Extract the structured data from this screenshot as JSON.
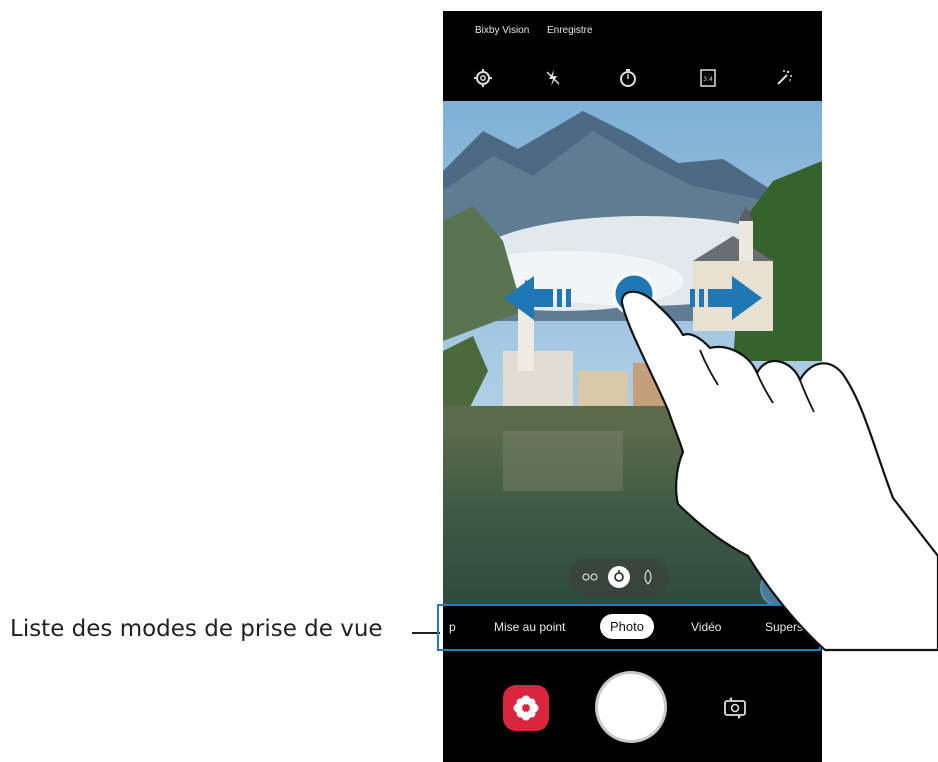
{
  "callout": {
    "label": "Liste des modes de prise de vue"
  },
  "camera": {
    "top_bar": {
      "items": [
        {
          "label": "Bixby Vision"
        },
        {
          "label": "Enregistre"
        }
      ]
    },
    "tools": [
      {
        "icon": "settings-icon"
      },
      {
        "icon": "flash-off-icon"
      },
      {
        "icon": "timer-off-icon"
      },
      {
        "icon": "aspect-ratio-icon",
        "label": "3:4"
      },
      {
        "icon": "filters-icon"
      }
    ],
    "zoom_lenses": [
      {
        "icon": "ultra-wide-lens-icon"
      },
      {
        "icon": "wide-lens-icon",
        "selected": true
      },
      {
        "icon": "telephoto-lens-icon"
      }
    ],
    "modes": [
      {
        "label": "p"
      },
      {
        "label": "Mise au point"
      },
      {
        "label": "Photo",
        "active": true
      },
      {
        "label": "Vidéo"
      },
      {
        "label": "Superso"
      }
    ],
    "controls": {
      "effects_icon": "effects-flower-icon",
      "shutter_icon": "shutter-button",
      "switch_icon": "switch-camera-icon"
    }
  },
  "gesture": {
    "type": "swipe-left-right",
    "icons": [
      "arrow-left-icon",
      "arrow-right-icon",
      "touch-point-icon",
      "hand-icon"
    ]
  },
  "colors": {
    "accent_blue": "#1f7fbf",
    "effects_red": "#d7263d"
  }
}
